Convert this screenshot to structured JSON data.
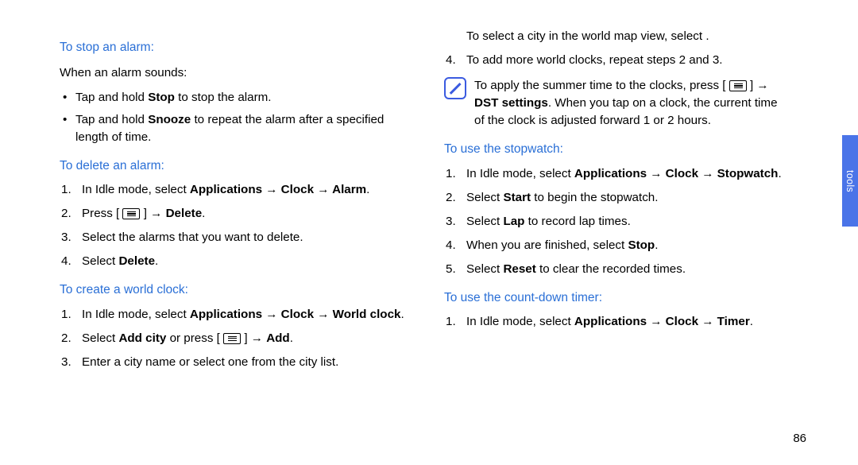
{
  "page_number": "86",
  "side_tab": "tools",
  "left": {
    "h1": "To stop an alarm:",
    "intro": "When an alarm sounds:",
    "b1_pre": "Tap and hold ",
    "b1_bold": "Stop",
    "b1_post": " to stop the alarm.",
    "b2_pre": "Tap and hold ",
    "b2_bold": "Snooze",
    "b2_post": " to repeat the alarm after a specified length of time.",
    "h2": "To delete an alarm:",
    "s1_pre": "In Idle mode, select ",
    "s1_bold": "Applications → Clock → Alarm",
    "s1_post": ".",
    "s2_pre": "Press [ ",
    "s2_mid": " ] → ",
    "s2_bold": "Delete",
    "s2_post": ".",
    "s3": "Select the alarms that you want to delete.",
    "s4_pre": "Select ",
    "s4_bold": "Delete",
    "s4_post": ".",
    "h3": "To create a world clock:",
    "w1_pre": "In Idle mode, select ",
    "w1_bold": "Applications → Clock → World clock",
    "w1_post": ".",
    "w2_pre": "Select ",
    "w2_bold1": "Add city",
    "w2_mid": " or press [ ",
    "w2_mid2": " ] → ",
    "w2_bold2": "Add",
    "w2_post": ".",
    "w3": "Enter a city name or select one from the city list."
  },
  "right": {
    "line_indent": "To select a city in the world map view, select        .",
    "s4": "To add more world clocks, repeat steps 2 and 3.",
    "note_pre": "To apply the summer time to the clocks, press [ ",
    "note_mid": " ] → ",
    "note_bold": "DST settings",
    "note_post": ". When you tap on a clock, the current time of the clock is adjusted forward 1 or 2 hours.",
    "h1": "To use the stopwatch:",
    "sw1_pre": "In Idle mode, select ",
    "sw1_bold": "Applications → Clock → Stopwatch",
    "sw1_post": ".",
    "sw2_pre": "Select ",
    "sw2_bold": "Start",
    "sw2_post": " to begin the stopwatch.",
    "sw3_pre": "Select ",
    "sw3_bold": "Lap",
    "sw3_post": " to record lap times.",
    "sw4_pre": "When you are finished, select ",
    "sw4_bold": "Stop",
    "sw4_post": ".",
    "sw5_pre": "Select ",
    "sw5_bold": "Reset",
    "sw5_post": " to clear the recorded times.",
    "h2": "To use the count-down timer:",
    "t1_pre": "In Idle mode, select ",
    "t1_bold": "Applications → Clock → Timer",
    "t1_post": "."
  }
}
